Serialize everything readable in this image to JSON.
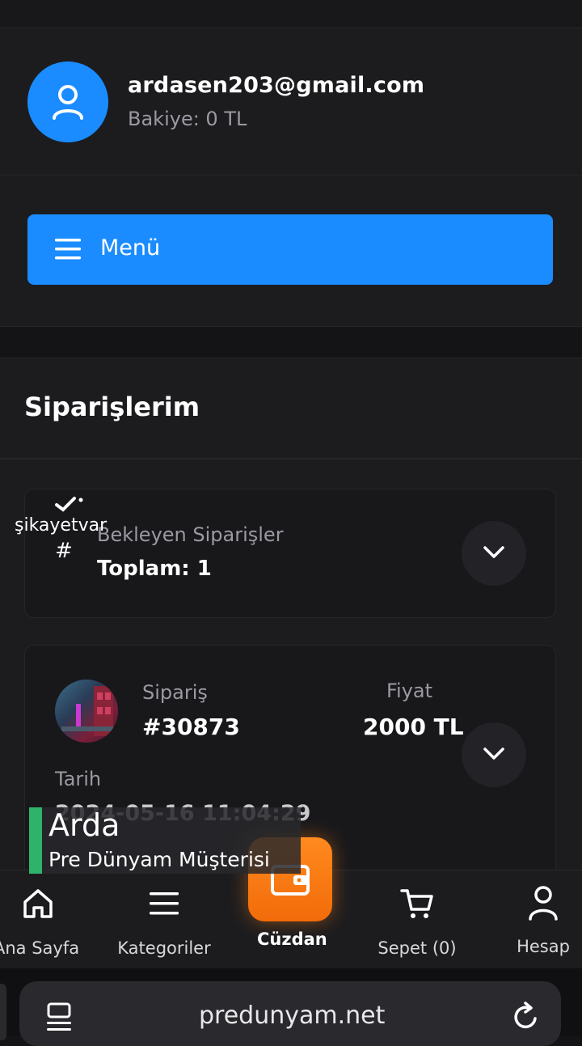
{
  "profile": {
    "email": "ardasen203@gmail.com",
    "balance": "Bakiye: 0 TL",
    "avatar_icon": "user-icon"
  },
  "menu": {
    "label": "Menü",
    "icon": "hamburger-icon"
  },
  "orders": {
    "title": "Siparişlerim",
    "pending": {
      "label": "Bekleyen Siparişler",
      "total": "Toplam: 1"
    },
    "order": {
      "label": "Sipariş",
      "id": "#30873",
      "price_label": "Fiyat",
      "price": "2000 TL",
      "date_label": "Tarih",
      "date": "2024-05-16 11:04:29"
    }
  },
  "watermark": {
    "brand": "şikayetvar",
    "hash": "#"
  },
  "lower_third": {
    "name": "Arda",
    "subtitle": "Pre Dünyam Müşterisi"
  },
  "bottom_nav": {
    "home": "Ana Sayfa",
    "categories": "Kategoriler",
    "wallet": "Cüzdan",
    "cart": "Sepet (0)",
    "account": "Hesap"
  },
  "browser": {
    "url": "predunyam.net"
  },
  "colors": {
    "accent": "#1a8cff",
    "wallet": "#f57a12",
    "background": "#141416",
    "lower_third_bar": "#2fb36a"
  }
}
